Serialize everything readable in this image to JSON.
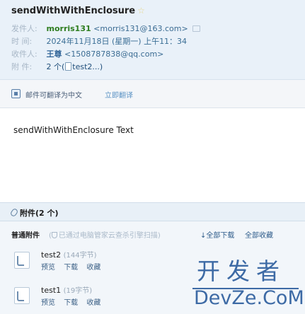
{
  "mail": {
    "subject": "sendWithWithEnclosure",
    "star_glyph": "☆",
    "from_label": "发件人:",
    "from_name": "morris131",
    "from_addr": "<morris131@163.com>",
    "time_label": "时  间:",
    "time_value": "2024年11月18日 (星期一) 上午11：34",
    "to_label": "收件人:",
    "to_name": "王尊",
    "to_addr": "<1508787838@qq.com>",
    "attach_label": "附  件:",
    "attach_count": "2 个",
    "attach_preview": "test2...",
    "paren_open": "(",
    "paren_close": ")"
  },
  "translate": {
    "text": "邮件可翻译为中文",
    "link": "立即翻译"
  },
  "body": {
    "text": "sendWithWithEnclosure Text"
  },
  "attachments": {
    "title": "附件(2 个)",
    "type_label": "普通附件",
    "hint": "已通过电脑管家云查杀引擎扫描)",
    "hint_open": "(",
    "download_all": "↓全部下载",
    "favorite_all": "全部收藏",
    "files": [
      {
        "name": "test2",
        "size": "(144字节)",
        "preview": "预览",
        "download": "下载",
        "favorite": "收藏"
      },
      {
        "name": "test1",
        "size": "(19字节)",
        "preview": "预览",
        "download": "下载",
        "favorite": "收藏"
      }
    ]
  },
  "watermark": {
    "cn": "开发者",
    "en": "DevZe.CoM"
  }
}
